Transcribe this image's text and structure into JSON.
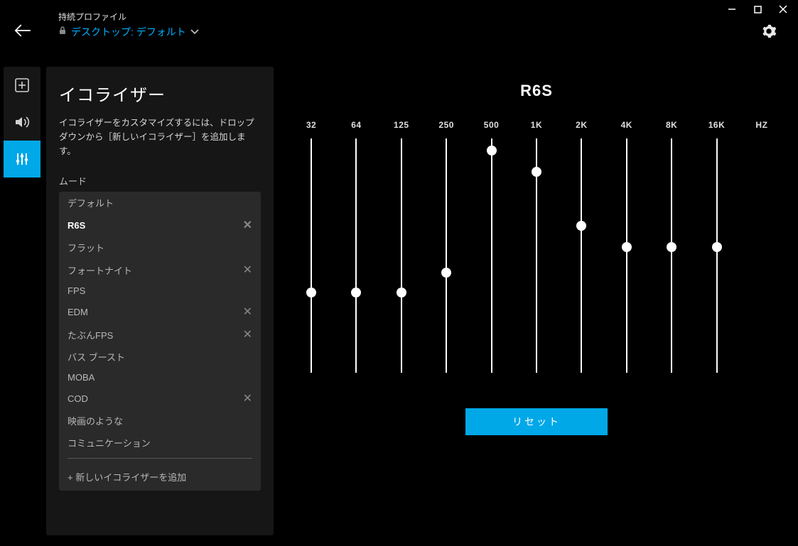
{
  "window": {
    "minimize": "—",
    "maximize": "▢",
    "close": "✕"
  },
  "header": {
    "profile_label": "持続プロファイル",
    "profile_value": "デスクトップ: デフォルト"
  },
  "panel": {
    "title": "イコライザー",
    "description": "イコライザーをカスタマイズするには、ドロップダウンから［新しいイコライザー］を追加します。",
    "mood_label": "ムード",
    "add_label": "+ 新しいイコライザーを追加",
    "presets": [
      {
        "name": "デフォルト",
        "deletable": false,
        "selected": false
      },
      {
        "name": "R6S",
        "deletable": true,
        "selected": true
      },
      {
        "name": "フラット",
        "deletable": false,
        "selected": false
      },
      {
        "name": "フォートナイト",
        "deletable": true,
        "selected": false
      },
      {
        "name": "FPS",
        "deletable": false,
        "selected": false
      },
      {
        "name": "EDM",
        "deletable": true,
        "selected": false
      },
      {
        "name": "たぶんFPS",
        "deletable": true,
        "selected": false
      },
      {
        "name": "バス ブースト",
        "deletable": false,
        "selected": false
      },
      {
        "name": "MOBA",
        "deletable": false,
        "selected": false
      },
      {
        "name": "COD",
        "deletable": true,
        "selected": false
      },
      {
        "name": "映画のような",
        "deletable": false,
        "selected": false
      },
      {
        "name": "コミュニケーション",
        "deletable": false,
        "selected": false
      }
    ]
  },
  "equalizer": {
    "title": "R6S",
    "reset_label": "リセット",
    "unit_label": "HZ",
    "bands": [
      {
        "freq": "32",
        "value": 0
      },
      {
        "freq": "64",
        "value": 0
      },
      {
        "freq": "125",
        "value": 0
      },
      {
        "freq": "250",
        "value": 14
      },
      {
        "freq": "500",
        "value": 100
      },
      {
        "freq": "1K",
        "value": 85
      },
      {
        "freq": "2K",
        "value": 47
      },
      {
        "freq": "4K",
        "value": 32
      },
      {
        "freq": "8K",
        "value": 32
      },
      {
        "freq": "16K",
        "value": 32
      }
    ]
  },
  "colors": {
    "accent": "#00a8e8",
    "link": "#00b0ff"
  }
}
